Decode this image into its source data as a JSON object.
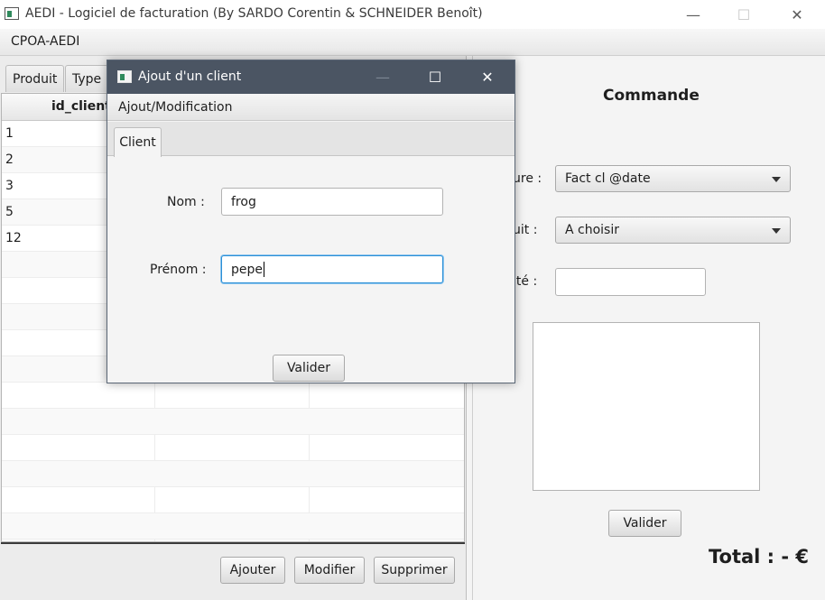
{
  "main_window": {
    "title": "AEDI - Logiciel de facturation (By SARDO Corentin & SCHNEIDER Benoît)",
    "controls": {
      "minimize": "—",
      "maximize": "☐",
      "close": "✕"
    }
  },
  "menubar": {
    "items": [
      "CPOA-AEDI"
    ]
  },
  "left_pane": {
    "tabs": [
      "Produit",
      "Type"
    ],
    "table": {
      "columns": [
        "id_client"
      ],
      "rows": [
        "1",
        "2",
        "3",
        "5",
        "12"
      ]
    },
    "buttons": {
      "add": "Ajouter",
      "modify": "Modifier",
      "delete": "Supprimer"
    }
  },
  "right_pane": {
    "title": "Commande",
    "labels": {
      "facture": "ure :",
      "produit": "uit :",
      "quantite": "ité :"
    },
    "facture_value": "Fact cl @date",
    "produit_value": "A choisir",
    "quantite_value": "",
    "validate": "Valider",
    "total": "Total : - €"
  },
  "dialog": {
    "title": "Ajout d'un client",
    "controls": {
      "minimize": "—",
      "maximize": "☐",
      "close": "✕"
    },
    "menu": "Ajout/Modification",
    "tab": "Client",
    "nom_label": "Nom :",
    "nom_value": "frog",
    "prenom_label": "Prénom :",
    "prenom_value": "pepe",
    "validate": "Valider"
  }
}
